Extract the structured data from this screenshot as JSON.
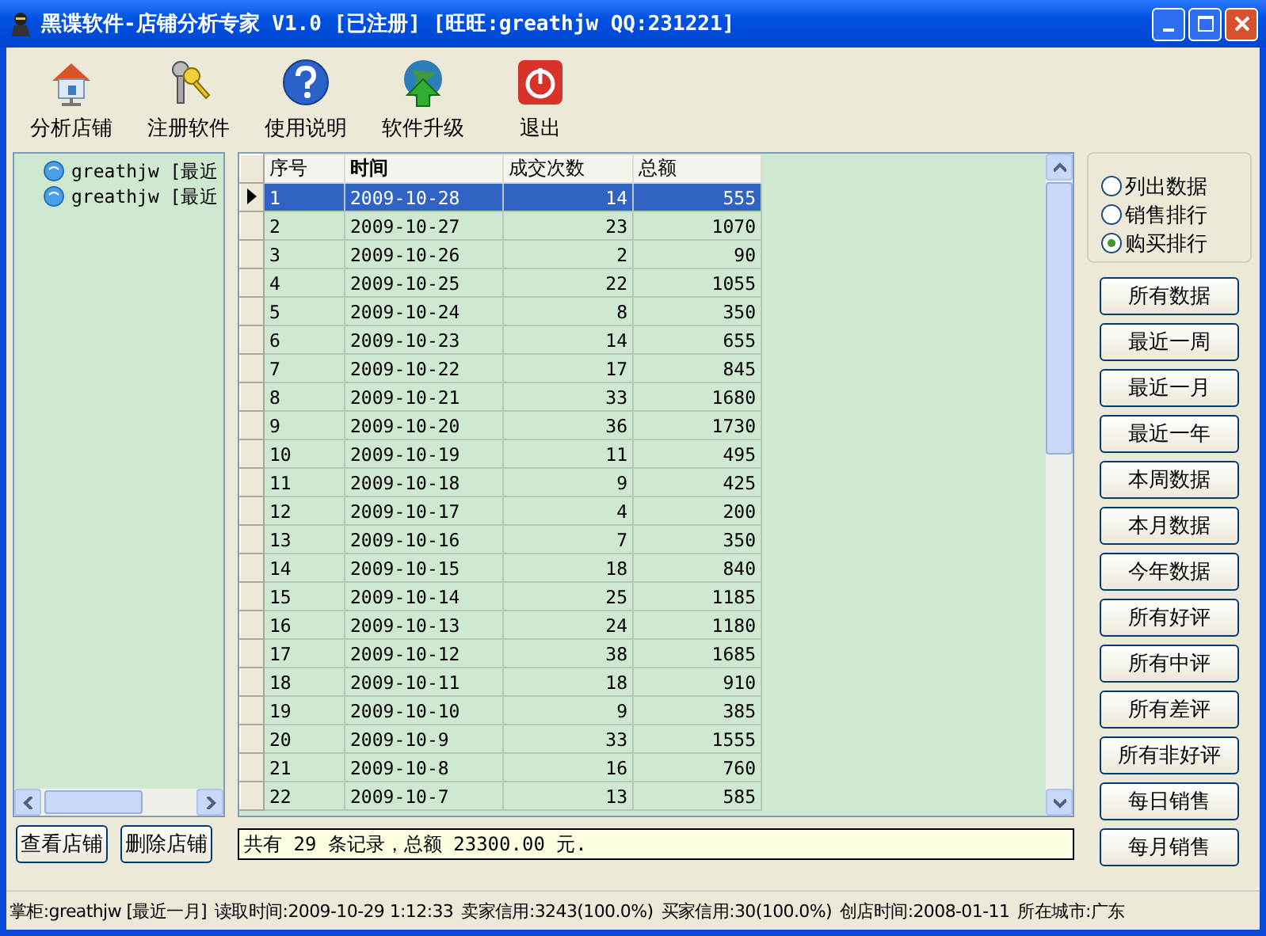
{
  "window": {
    "title": "黑谍软件-店铺分析专家 V1.0 [已注册] [旺旺:greathjw QQ:231221]"
  },
  "toolbar": [
    {
      "kind": "house",
      "label": "分析店铺"
    },
    {
      "kind": "keys",
      "label": "注册软件"
    },
    {
      "kind": "help",
      "label": "使用说明"
    },
    {
      "kind": "upgrade",
      "label": "软件升级"
    },
    {
      "kind": "exit",
      "label": "退出"
    }
  ],
  "tree": {
    "items": [
      {
        "label": "greathjw [最近"
      },
      {
        "label": "greathjw [最近"
      }
    ]
  },
  "table": {
    "columns": [
      "序号",
      "时间",
      "成交次数",
      "总额"
    ],
    "rows": [
      {
        "cells": [
          "1",
          "2009-10-28",
          "14",
          "555"
        ],
        "selected": true
      },
      {
        "cells": [
          "2",
          "2009-10-27",
          "23",
          "1070"
        ],
        "selected": false
      },
      {
        "cells": [
          "3",
          "2009-10-26",
          "2",
          "90"
        ],
        "selected": false
      },
      {
        "cells": [
          "4",
          "2009-10-25",
          "22",
          "1055"
        ],
        "selected": false
      },
      {
        "cells": [
          "5",
          "2009-10-24",
          "8",
          "350"
        ],
        "selected": false
      },
      {
        "cells": [
          "6",
          "2009-10-23",
          "14",
          "655"
        ],
        "selected": false
      },
      {
        "cells": [
          "7",
          "2009-10-22",
          "17",
          "845"
        ],
        "selected": false
      },
      {
        "cells": [
          "8",
          "2009-10-21",
          "33",
          "1680"
        ],
        "selected": false
      },
      {
        "cells": [
          "9",
          "2009-10-20",
          "36",
          "1730"
        ],
        "selected": false
      },
      {
        "cells": [
          "10",
          "2009-10-19",
          "11",
          "495"
        ],
        "selected": false
      },
      {
        "cells": [
          "11",
          "2009-10-18",
          "9",
          "425"
        ],
        "selected": false
      },
      {
        "cells": [
          "12",
          "2009-10-17",
          "4",
          "200"
        ],
        "selected": false
      },
      {
        "cells": [
          "13",
          "2009-10-16",
          "7",
          "350"
        ],
        "selected": false
      },
      {
        "cells": [
          "14",
          "2009-10-15",
          "18",
          "840"
        ],
        "selected": false
      },
      {
        "cells": [
          "15",
          "2009-10-14",
          "25",
          "1185"
        ],
        "selected": false
      },
      {
        "cells": [
          "16",
          "2009-10-13",
          "24",
          "1180"
        ],
        "selected": false
      },
      {
        "cells": [
          "17",
          "2009-10-12",
          "38",
          "1685"
        ],
        "selected": false
      },
      {
        "cells": [
          "18",
          "2009-10-11",
          "18",
          "910"
        ],
        "selected": false
      },
      {
        "cells": [
          "19",
          "2009-10-10",
          "9",
          "385"
        ],
        "selected": false
      },
      {
        "cells": [
          "20",
          "2009-10-9",
          "33",
          "1555"
        ],
        "selected": false
      },
      {
        "cells": [
          "21",
          "2009-10-8",
          "16",
          "760"
        ],
        "selected": false
      },
      {
        "cells": [
          "22",
          "2009-10-7",
          "13",
          "585"
        ],
        "selected": false
      }
    ]
  },
  "options": [
    {
      "label": "列出数据",
      "selected": false
    },
    {
      "label": "销售排行",
      "selected": false
    },
    {
      "label": "购买排行",
      "selected": true
    }
  ],
  "filter_buttons": [
    "所有数据",
    "最近一周",
    "最近一月",
    "最近一年",
    "本周数据",
    "本月数据",
    "今年数据",
    "所有好评",
    "所有中评",
    "所有差评",
    "所有非好评",
    "每日销售",
    "每月销售"
  ],
  "shop_buttons": [
    "查看店铺",
    "删除店铺"
  ],
  "summary": "共有 29 条记录，总额 23300.00 元.",
  "status_bar": [
    "掌柜:greathjw [最近一月]",
    "读取时间:2009-10-29 1:12:33",
    "卖家信用:3243(100.0%)",
    "买家信用:30(100.0%)",
    "创店时间:2008-01-11",
    "所在城市:广东"
  ]
}
